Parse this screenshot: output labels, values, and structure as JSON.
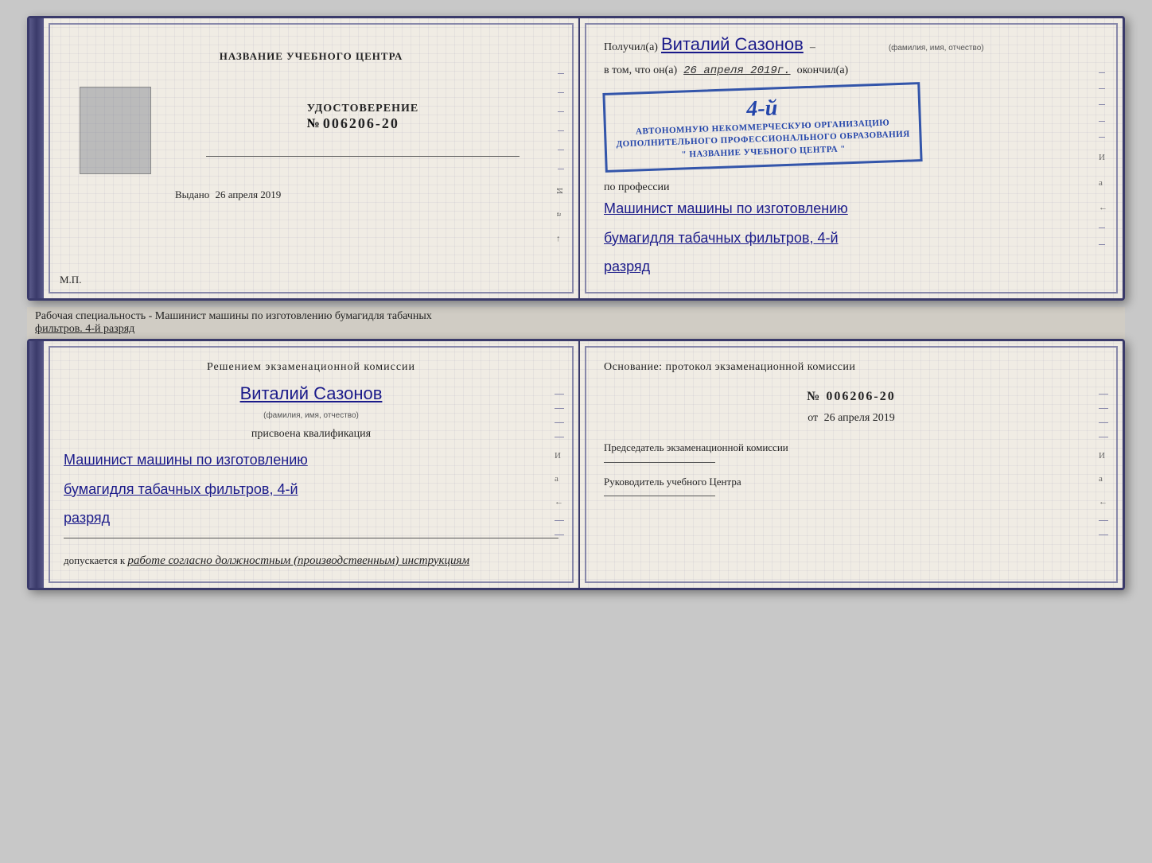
{
  "topBook": {
    "left": {
      "title": "НАЗВАНИЕ УЧЕБНОГО ЦЕНТРА",
      "udostoverenie_label": "УДОСТОВЕРЕНИЕ",
      "nomer_prefix": "№",
      "nomer": "006206-20",
      "vydano_label": "Выдано",
      "vydano_date": "26 апреля 2019",
      "mp": "М.П."
    },
    "right": {
      "poluchil_label": "Получил(а)",
      "recipient_name": "Виталий Сазонов",
      "fio_label": "(фамилия, имя, отчество)",
      "vtom_label": "в том, что он(a)",
      "date_value": "26 апреля 2019г.",
      "okonchil_label": "окончил(а)",
      "stamp_line1": "АВТОНОМНУЮ НЕКОММЕРЧЕСКУЮ ОРГАНИЗАЦИЮ",
      "stamp_line2": "ДОПОЛНИТЕЛЬНОГО ПРОФЕССИОНАЛЬНОГО ОБРАЗОВАНИЯ",
      "stamp_line3": "\" НАЗВАНИЕ УЧЕБНОГО ЦЕНТРА \"",
      "stamp_number": "4-й",
      "po_professii_label": "по профессии",
      "profession_line1": "Машинист машины по изготовлению",
      "profession_line2": "бумагидля табачных фильтров, 4-й",
      "profession_line3": "разряд"
    }
  },
  "separator": {
    "text": "Рабочая специальность - Машинист машины по изготовлению бумагидля табачных",
    "text2": "фильтров. 4-й разряд"
  },
  "bottomBook": {
    "left": {
      "resheniem_label": "Решением экзаменационной комиссии",
      "name": "Виталий Сазонов",
      "fio_label": "(фамилия, имя, отчество)",
      "prisvoena_label": "присвоена квалификация",
      "qual_line1": "Машинист машины по изготовлению",
      "qual_line2": "бумагидля табачных фильтров, 4-й",
      "qual_line3": "разряд",
      "dopuskaetsya_label": "допускается к",
      "dopusk_value": "работе согласно должностным (производственным) инструкциям"
    },
    "right": {
      "osnovanie_label": "Основание: протокол экзаменационной комиссии",
      "nomer_prefix": "№",
      "nomer": "006206-20",
      "ot_prefix": "от",
      "ot_date": "26 апреля 2019",
      "predsedatel_label": "Председатель экзаменационной комиссии",
      "rukovoditel_label": "Руководитель учебного Центра"
    }
  }
}
